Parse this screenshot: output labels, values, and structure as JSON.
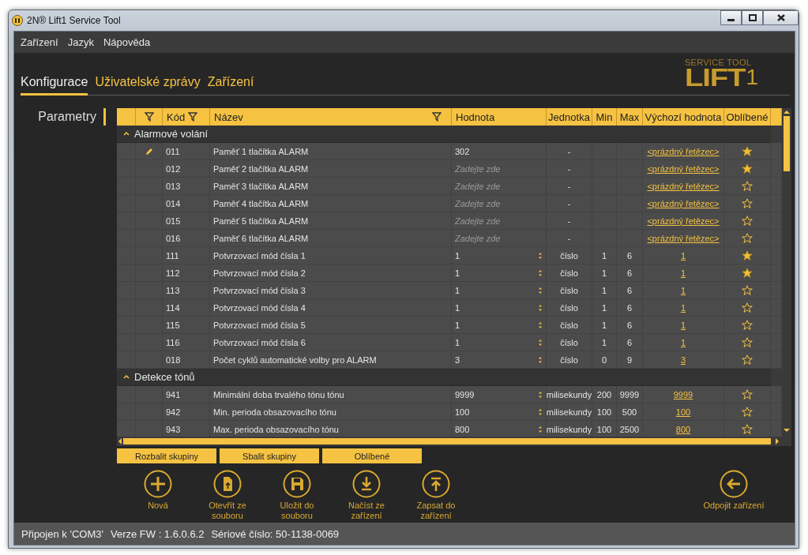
{
  "window": {
    "title": "2N® Lift1 Service Tool"
  },
  "menu": [
    "Zařízení",
    "Jazyk",
    "Nápověda"
  ],
  "tabs": [
    {
      "label": "Konfigurace",
      "selected": true
    },
    {
      "label": "Uživatelské zprávy",
      "selected": false
    },
    {
      "label": "Zařízení",
      "selected": false
    }
  ],
  "logo": {
    "subtitle": "SERVICE TOOL",
    "name": "LIFT",
    "digit": "1"
  },
  "sidebar": {
    "items": [
      {
        "label": "Parametry",
        "selected": true
      }
    ]
  },
  "table": {
    "row_filter": true,
    "columns": [
      {
        "label": "Kód",
        "filter": true
      },
      {
        "label": "Název",
        "filter": true
      },
      {
        "label": "Hodnota",
        "filter": false
      },
      {
        "label": "Jednotka",
        "filter": false
      },
      {
        "label": "Min",
        "filter": false
      },
      {
        "label": "Max",
        "filter": false
      },
      {
        "label": "Výchozí hodnota",
        "filter": false
      },
      {
        "label": "Oblíbené",
        "filter": false
      }
    ],
    "groups": [
      {
        "name": "Alarmové volání",
        "expanded": true,
        "rows": [
          {
            "editing": true,
            "code": "011",
            "name": "Paměť 1 tlačítka ALARM",
            "kind": "text",
            "value": "302",
            "unit": "-",
            "default": "<prázdný řetězec>",
            "favorite": true
          },
          {
            "editing": false,
            "code": "012",
            "name": "Paměť 2 tlačítka ALARM",
            "kind": "text",
            "placeholder": "Zadejte zde",
            "unit": "-",
            "default": "<prázdný řetězec>",
            "favorite": true
          },
          {
            "editing": false,
            "code": "013",
            "name": "Paměť 3 tlačítka ALARM",
            "kind": "text",
            "placeholder": "Zadejte zde",
            "unit": "-",
            "default": "<prázdný řetězec>",
            "favorite": false
          },
          {
            "editing": false,
            "code": "014",
            "name": "Paměť 4 tlačítka ALARM",
            "kind": "text",
            "placeholder": "Zadejte zde",
            "unit": "-",
            "default": "<prázdný řetězec>",
            "favorite": false
          },
          {
            "editing": false,
            "code": "015",
            "name": "Paměť 5 tlačítka ALARM",
            "kind": "text",
            "placeholder": "Zadejte zde",
            "unit": "-",
            "default": "<prázdný řetězec>",
            "favorite": false
          },
          {
            "editing": false,
            "code": "016",
            "name": "Paměť 6 tlačítka ALARM",
            "kind": "text",
            "placeholder": "Zadejte zde",
            "unit": "-",
            "default": "<prázdný řetězec>",
            "favorite": false
          },
          {
            "editing": false,
            "code": "111",
            "name": "Potvrzovací mód čísla 1",
            "kind": "number",
            "value": "1",
            "unit": "číslo",
            "min": "1",
            "max": "6",
            "default": "1",
            "favorite": true
          },
          {
            "editing": false,
            "code": "112",
            "name": "Potvrzovací mód čísla 2",
            "kind": "number",
            "value": "1",
            "unit": "číslo",
            "min": "1",
            "max": "6",
            "default": "1",
            "favorite": true
          },
          {
            "editing": false,
            "code": "113",
            "name": "Potvrzovací mód čísla 3",
            "kind": "number",
            "value": "1",
            "unit": "číslo",
            "min": "1",
            "max": "6",
            "default": "1",
            "favorite": false
          },
          {
            "editing": false,
            "code": "114",
            "name": "Potvrzovací mód čísla 4",
            "kind": "number",
            "value": "1",
            "unit": "číslo",
            "min": "1",
            "max": "6",
            "default": "1",
            "favorite": false
          },
          {
            "editing": false,
            "code": "115",
            "name": "Potvrzovací mód čísla 5",
            "kind": "number",
            "value": "1",
            "unit": "číslo",
            "min": "1",
            "max": "6",
            "default": "1",
            "favorite": false
          },
          {
            "editing": false,
            "code": "116",
            "name": "Potvrzovací mód čísla 6",
            "kind": "number",
            "value": "1",
            "unit": "číslo",
            "min": "1",
            "max": "6",
            "default": "1",
            "favorite": false
          },
          {
            "editing": false,
            "code": "018",
            "name": "Počet cyklů automatické volby pro ALARM",
            "kind": "number",
            "value": "3",
            "unit": "číslo",
            "min": "0",
            "max": "9",
            "default": "3",
            "favorite": false
          }
        ]
      },
      {
        "name": "Detekce tónů",
        "expanded": true,
        "rows": [
          {
            "editing": false,
            "code": "941",
            "name": "Minimální doba trvalého tónu tónu",
            "kind": "number",
            "value": "9999",
            "unit": "milisekundy",
            "min": "200",
            "max": "9999",
            "default": "9999",
            "favorite": false
          },
          {
            "editing": false,
            "code": "942",
            "name": "Min. perioda obsazovacího tónu",
            "kind": "number",
            "value": "100",
            "unit": "milisekundy",
            "min": "100",
            "max": "500",
            "default": "100",
            "favorite": false
          },
          {
            "editing": false,
            "code": "943",
            "name": "Max. perioda obsazovacího tónu",
            "kind": "number",
            "value": "800",
            "unit": "milisekundy",
            "min": "100",
            "max": "2500",
            "default": "800",
            "favorite": false
          }
        ]
      }
    ]
  },
  "table_buttons": [
    "Rozbalit skupiny",
    "Sbalit skupiny",
    "Oblíbené"
  ],
  "actions": [
    {
      "kind": "new",
      "label": "Nová"
    },
    {
      "kind": "open",
      "label": "Otevřít ze souboru"
    },
    {
      "kind": "save",
      "label": "Uložit do souboru"
    },
    {
      "kind": "read",
      "label": "Načíst ze zařízení"
    },
    {
      "kind": "write",
      "label": "Zapsat do zařízení"
    },
    {
      "kind": "disconnect",
      "label": "Odpojit zařízení"
    }
  ],
  "status_bar": [
    "Připojen k 'COM3'",
    "Verze FW : 1.6.0.6.2",
    "Sériové číslo: 50-1138-0069"
  ]
}
